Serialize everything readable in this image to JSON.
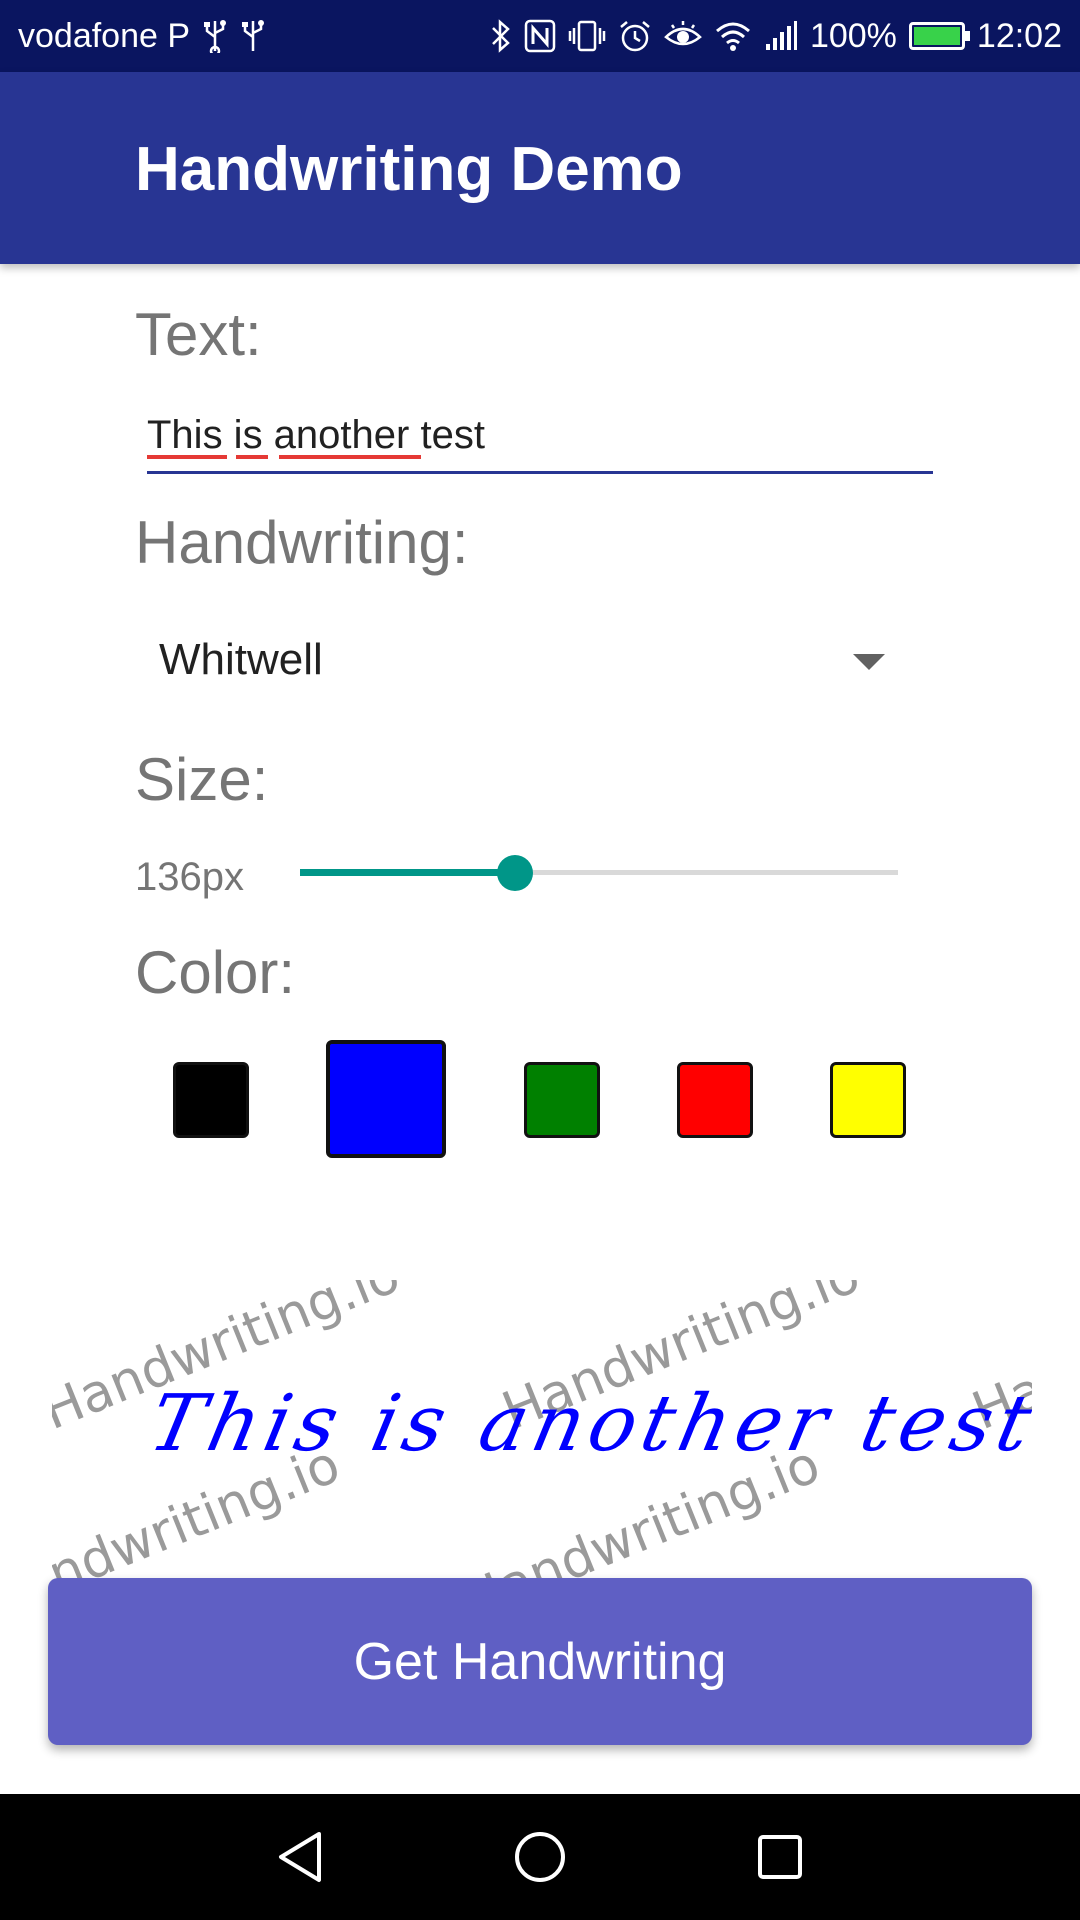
{
  "status_bar": {
    "carrier": "vodafone P",
    "battery_label": "100%",
    "battery_level": 1.0,
    "time": "12:02",
    "icons": [
      "usb-icon",
      "usb-icon",
      "bluetooth-icon",
      "nfc-icon",
      "vibrate-icon",
      "alarm-icon",
      "eye-comfort-icon",
      "wifi-icon",
      "signal-icon",
      "battery-icon"
    ]
  },
  "app_bar": {
    "title": "Handwriting Demo"
  },
  "form": {
    "text_label": "Text:",
    "text_value": "This is another test",
    "handwriting_label": "Handwriting:",
    "handwriting_selected": "Whitwell",
    "size_label": "Size:",
    "size_value": "136px",
    "size_slider_fraction": 0.36,
    "color_label": "Color:",
    "colors": [
      {
        "name": "black",
        "hex": "#000000",
        "selected": false
      },
      {
        "name": "blue",
        "hex": "#0000ff",
        "selected": true
      },
      {
        "name": "green",
        "hex": "#008000",
        "selected": false
      },
      {
        "name": "red",
        "hex": "#ff0000",
        "selected": false
      },
      {
        "name": "yellow",
        "hex": "#ffff00",
        "selected": false
      }
    ],
    "accent_color": "#283593",
    "slider_color": "#009688"
  },
  "preview": {
    "handwritten_text": "This is another test",
    "ink_color": "#0000ff",
    "watermark": "Handwriting.io"
  },
  "action_button": {
    "label": "Get Handwriting",
    "color": "#5f5fc4"
  },
  "nav_bar": {
    "icons": [
      "back-icon",
      "home-icon",
      "recents-icon"
    ]
  }
}
